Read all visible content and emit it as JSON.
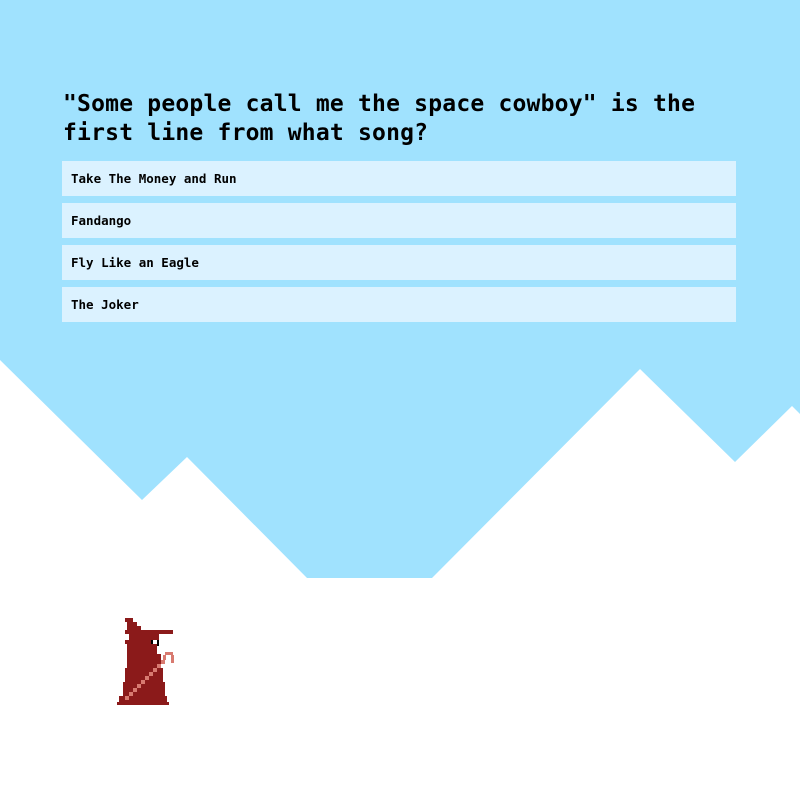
{
  "quiz": {
    "question": "\"Some people call me the space cowboy\" is the first line from what song?",
    "answers": [
      {
        "label": "Take The Money and Run"
      },
      {
        "label": "Fandango"
      },
      {
        "label": "Fly Like an Eagle"
      },
      {
        "label": "The Joker"
      }
    ]
  },
  "colors": {
    "sky": "#a0e2fe",
    "answer_bg": "#dbf2ff",
    "snow": "#ffffff",
    "wizard_robe": "#8b1a1a",
    "staff": "#d87a70"
  }
}
